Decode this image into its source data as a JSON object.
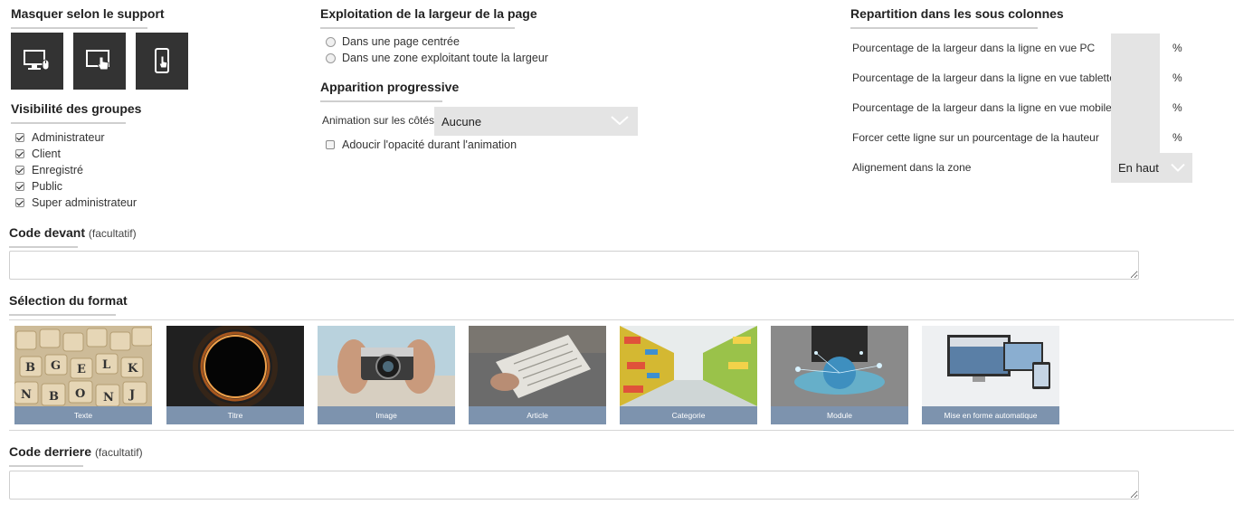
{
  "support": {
    "heading": "Masquer selon le support",
    "buttons": [
      {
        "icon": "desktop-mouse-icon"
      },
      {
        "icon": "tablet-touch-icon"
      },
      {
        "icon": "mobile-touch-icon"
      }
    ]
  },
  "groups": {
    "heading": "Visibilité des groupes",
    "items": [
      {
        "label": "Administrateur",
        "checked": true
      },
      {
        "label": "Client",
        "checked": true
      },
      {
        "label": "Enregistré",
        "checked": true
      },
      {
        "label": "Public",
        "checked": true
      },
      {
        "label": "Super administrateur",
        "checked": true
      }
    ]
  },
  "width_usage": {
    "heading": "Exploitation de la largeur de la page",
    "options": [
      {
        "label": "Dans une page centrée",
        "selected": false
      },
      {
        "label": "Dans une zone exploitant toute la largeur",
        "selected": false
      }
    ]
  },
  "progressive": {
    "heading": "Apparition progressive",
    "animation_label": "Animation sur les côtés",
    "animation_value": "Aucune",
    "opacity_label": "Adoucir l'opacité durant l'animation",
    "opacity_checked": false
  },
  "columns": {
    "heading": "Repartition dans les sous colonnes",
    "rows": [
      {
        "label": "Pourcentage de la largeur dans la ligne en vue PC",
        "value": "",
        "unit": "%"
      },
      {
        "label": "Pourcentage de la largeur dans la ligne en vue tablette",
        "value": "",
        "unit": "%"
      },
      {
        "label": "Pourcentage de la largeur dans la ligne en vue mobile",
        "value": "",
        "unit": "%"
      },
      {
        "label": "Forcer cette ligne sur un pourcentage de la hauteur",
        "value": "",
        "unit": "%"
      }
    ],
    "alignment_label": "Alignement dans la zone",
    "alignment_value": "En haut"
  },
  "code_before": {
    "heading": "Code devant",
    "note": "(facultatif)",
    "value": ""
  },
  "format": {
    "heading": "Sélection du format",
    "tiles": [
      {
        "label": "Texte"
      },
      {
        "label": "Titre"
      },
      {
        "label": "Image"
      },
      {
        "label": "Article"
      },
      {
        "label": "Categorie"
      },
      {
        "label": "Module"
      },
      {
        "label": "Mise en forme automatique"
      }
    ]
  },
  "code_after": {
    "heading": "Code derriere",
    "note": "(facultatif)",
    "value": ""
  },
  "colors": {
    "dark_button": "#333333",
    "field_bg": "#e4e4e4",
    "caption_bg": "#7d93ae",
    "heading_underline": "#cfcfcf"
  }
}
